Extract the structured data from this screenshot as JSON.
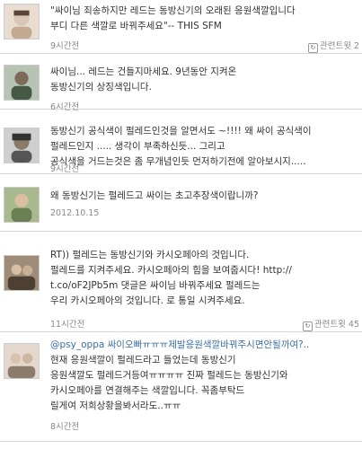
{
  "tweets": [
    {
      "lines": [
        "\"싸이님 죄송하지만 레드는 동방신기의 오래된 응원색깔입니다",
        "부디 다른 색깔로 바꿔주세요\"-- THIS SFM"
      ],
      "time": "9시간전",
      "related": "관련트윗 2",
      "avatar_color": "#d9c7b5"
    },
    {
      "lines": [
        "싸이님... 레드는 건들지마세요. 9년동안 지켜온",
        "동방신기의 상징색입니다."
      ],
      "time": "6시간전",
      "related": "",
      "avatar_color": "#7d8f7a"
    },
    {
      "lines": [
        "동방신기 공식색이 펄레드인것을 알면서도 ~!!!! 왜 싸이 공식색이",
        "펄레드인지 ..... 생각이 부족하신듯... 그리고",
        "공식색을 거드는것은 좀 무개념인듯 먼저하기전에 알아보시지....."
      ],
      "time": "9시간전",
      "related": "",
      "avatar_color": "#555555"
    },
    {
      "lines": [
        "왜 동방신기는 펄레드고 싸이는 초고추장색이랍니까?"
      ],
      "time": "2012.10.15",
      "related": "",
      "avatar_color": "#8fa57a"
    },
    {
      "lines": [
        "RT)) 펄레드는 동방신기와 카시오페아의 것입니다.",
        "펄레드를 지켜주세요. 카시오페아의 힘을 보여줍시다! http://",
        "t.co/oF2JPb5m 댓글은 싸이님 바꿔주세요 펄레드는",
        "우리 카시오페아의 것입니다. 로 통일 시켜주세요."
      ],
      "time": "11시간전",
      "related": "관련트윗 45",
      "avatar_color": "#6b5a4a"
    },
    {
      "lines": [
        "@psy_oppa 싸이오빠ㅠㅠㅠ제발응원색깔바꿔주시면안될까여?..",
        "현재 응원색깔이 펄레드라고 들었는데 동방신기",
        "응원색깔도 펄레드거등여ㅠㅠㅠㅠ 진짜 펄레드는 동방신기와",
        "카시오페아를 연결해주는 색깔입니다. 꼭좀부탁드",
        "릴게여 저희상황을봐서라도..ㅠㅠ"
      ],
      "time": "8시간전",
      "related": "",
      "avatar_color": "#c9b8a6"
    }
  ]
}
